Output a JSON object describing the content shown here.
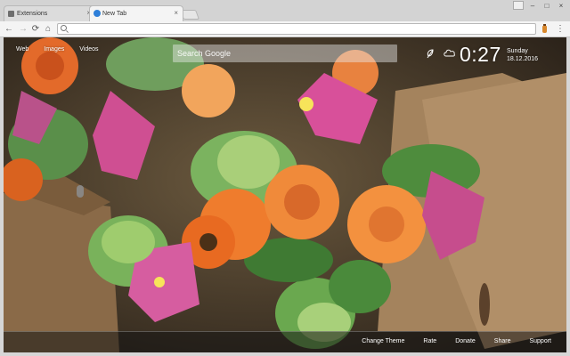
{
  "browser": {
    "tabs": [
      {
        "title": "Extensions",
        "icon": "puzzle-icon",
        "active": false
      },
      {
        "title": "New Tab",
        "icon": "globe-icon",
        "active": true
      }
    ],
    "tab_close_glyph": "×",
    "window_controls": {
      "minimize": "–",
      "maximize": "□",
      "close": "×"
    },
    "omnibox": {
      "value": "",
      "placeholder": ""
    },
    "nav_glyphs": {
      "back": "←",
      "forward": "→",
      "reload": "⟳",
      "home": "⌂"
    },
    "menu_glyph": "⋮"
  },
  "newtab": {
    "top_links": [
      "Web",
      "Images",
      "Videos"
    ],
    "search": {
      "placeholder": "Search Google"
    },
    "clock": "0:27",
    "date": {
      "day": "Sunday",
      "date": "18.12.2016"
    },
    "bottom_links": [
      "Change Theme",
      "Rate",
      "Donate",
      "Share",
      "Support"
    ]
  },
  "colors": {
    "overlay_text": "#ffffff",
    "chrome_bg": "#d3d3d3",
    "toolbar_bg": "#f4f4f4"
  }
}
